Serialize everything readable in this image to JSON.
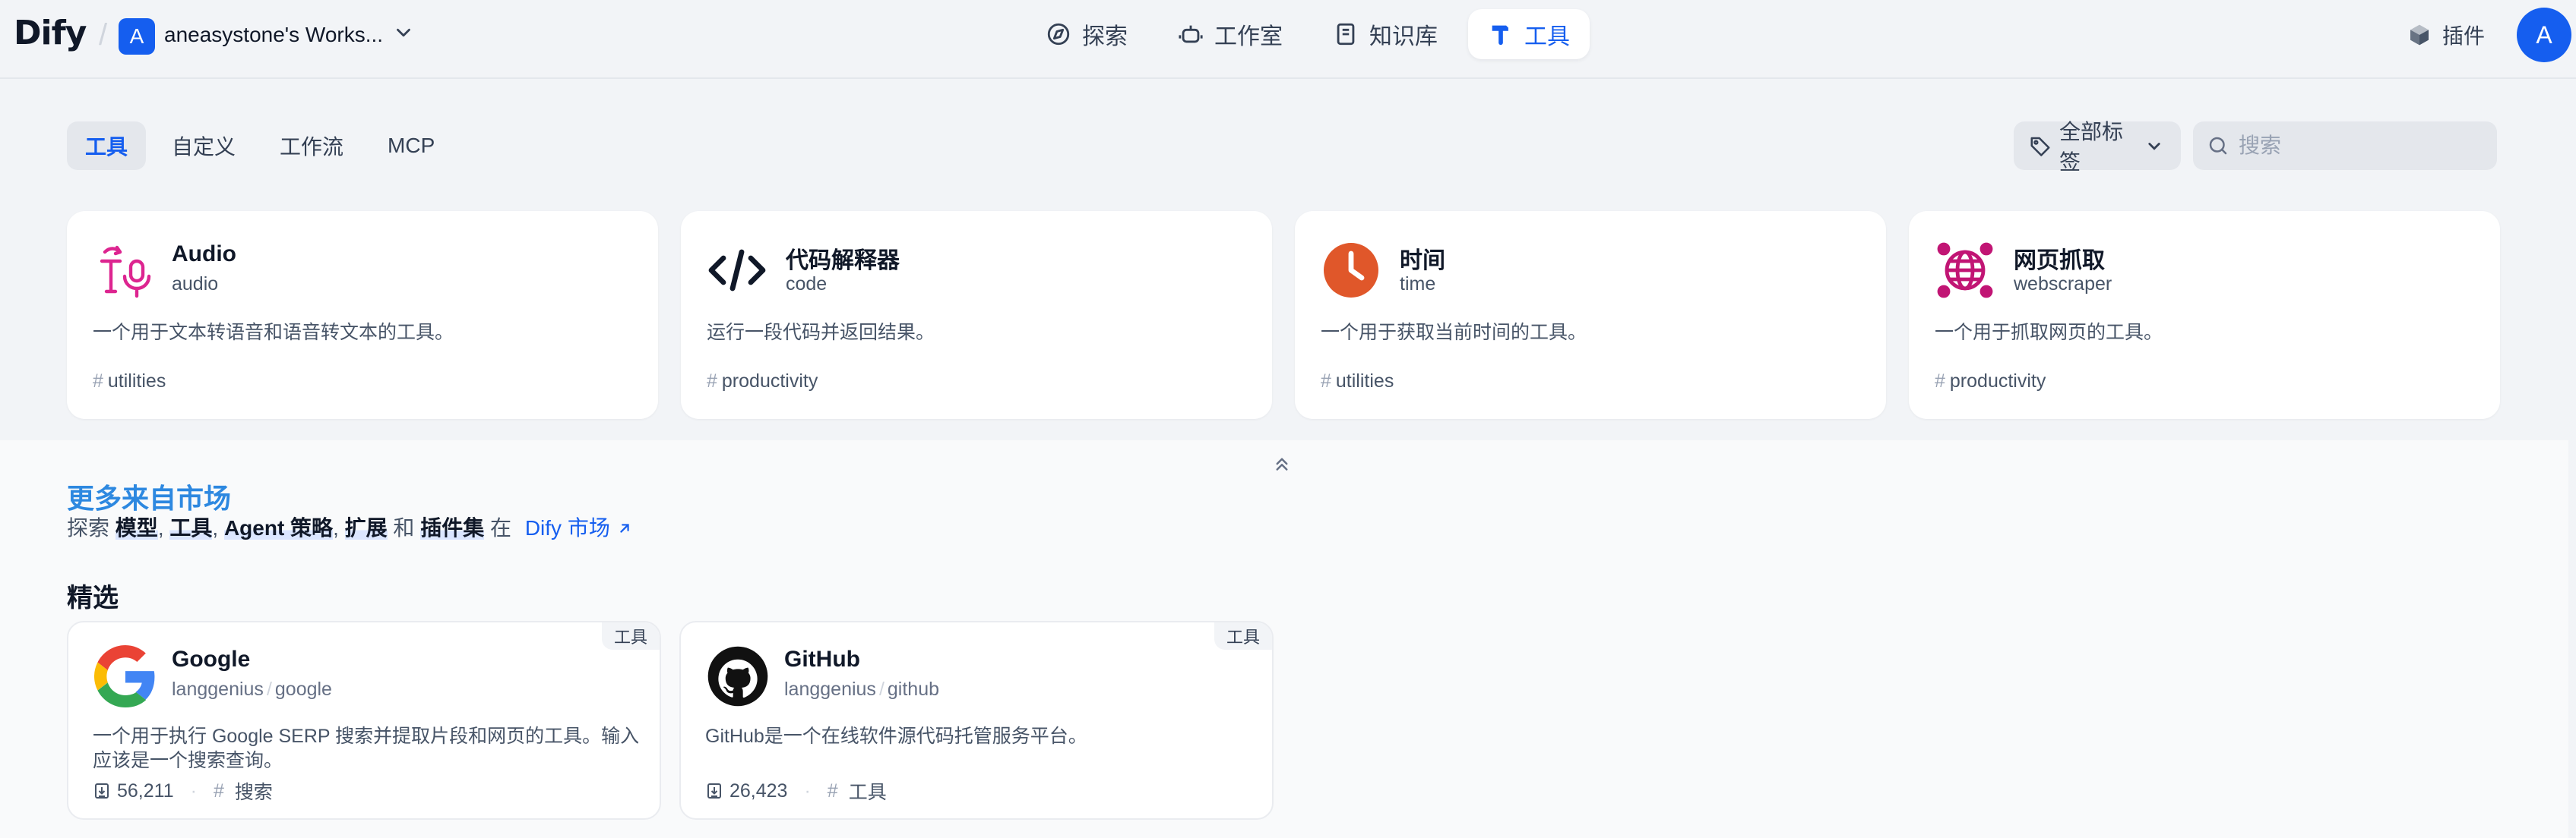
{
  "app": {
    "logo_text": "Dify"
  },
  "workspace": {
    "avatar_letter": "A",
    "name": "aneasystone's Works..."
  },
  "nav": {
    "items": [
      {
        "label": "探索",
        "icon": "compass-icon",
        "active": false
      },
      {
        "label": "工作室",
        "icon": "robot-icon",
        "active": false
      },
      {
        "label": "知识库",
        "icon": "book-icon",
        "active": false
      },
      {
        "label": "工具",
        "icon": "hammer-icon",
        "active": true
      }
    ]
  },
  "header": {
    "plugins_label": "插件",
    "user_avatar_letter": "A"
  },
  "tabs": [
    "工具",
    "自定义",
    "工作流",
    "MCP"
  ],
  "filters": {
    "tag_label": "全部标签",
    "search_placeholder": "搜索"
  },
  "tools": [
    {
      "name": "Audio",
      "id": "audio",
      "description": "一个用于文本转语音和语音转文本的工具。",
      "tag": "utilities",
      "icon": "audio-tool-icon"
    },
    {
      "name": "代码解释器",
      "id": "code",
      "description": "运行一段代码并返回结果。",
      "tag": "productivity",
      "icon": "code-tool-icon"
    },
    {
      "name": "时间",
      "id": "time",
      "description": "一个用于获取当前时间的工具。",
      "tag": "utilities",
      "icon": "clock-tool-icon"
    },
    {
      "name": "网页抓取",
      "id": "webscraper",
      "description": "一个用于抓取网页的工具。",
      "tag": "productivity",
      "icon": "globe-tool-icon"
    }
  ],
  "marketplace": {
    "title": "更多来自市场",
    "sub_prefix": "探索",
    "sub_models": "模型",
    "sub_tools": "工具",
    "sub_agent": "Agent 策略",
    "sub_ext": "扩展",
    "sub_and": "和",
    "sub_bundles": "插件集",
    "sub_in": "在",
    "sub_link": "Dify 市场",
    "comma": ",",
    "featured_title": "精选"
  },
  "featured": [
    {
      "name": "Google",
      "org": "langgenius",
      "slug": "google",
      "badge": "工具",
      "description": "一个用于执行 Google SERP 搜索并提取片段和网页的工具。输入应该是一个搜索查询。",
      "installs": "56,211",
      "tag": "搜索",
      "icon": "google-logo-icon"
    },
    {
      "name": "GitHub",
      "org": "langgenius",
      "slug": "github",
      "badge": "工具",
      "description": "GitHub是一个在线软件源代码托管服务平台。",
      "installs": "26,423",
      "tag": "工具",
      "icon": "github-logo-icon"
    }
  ],
  "colors": {
    "accent": "#155eef",
    "market_title": "#2d88e0",
    "audio_pink": "#dd2590",
    "time_orange": "#e0572a"
  }
}
